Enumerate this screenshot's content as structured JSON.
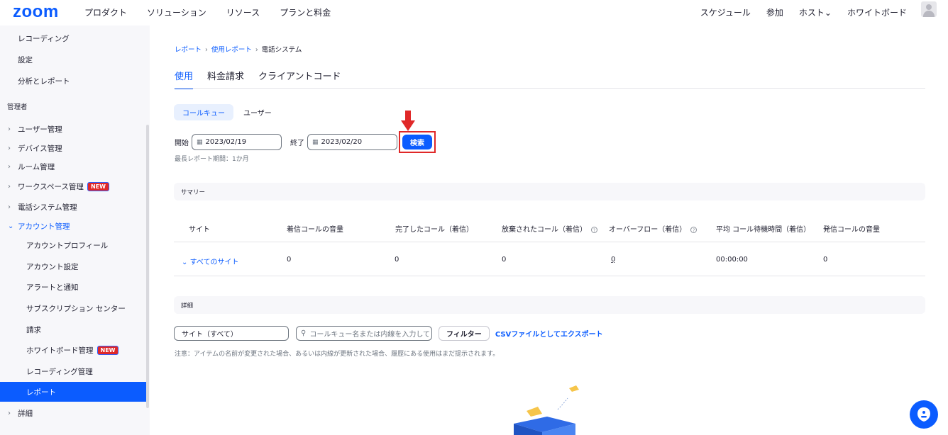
{
  "topnav": {
    "logo": "zoom",
    "left_items": [
      "プロダクト",
      "ソリューション",
      "リソース",
      "プランと料金"
    ],
    "right_items": [
      "スケジュール",
      "参加",
      "ホスト⌄",
      "ホワイトボード"
    ]
  },
  "sidebar": {
    "top_items": [
      "レコーディング",
      "設定",
      "分析とレポート"
    ],
    "section_label": "管理者",
    "groups": [
      "ユーザー管理",
      "デバイス管理",
      "ルーム管理",
      "ワークスペース管理",
      "電話システム管理",
      "アカウント管理"
    ],
    "sub_items": [
      "アカウントプロフィール",
      "アカウント設定",
      "アラートと通知",
      "サブスクリプション センター",
      "請求",
      "ホワイトボード管理",
      "レコーディング管理",
      "レポート"
    ],
    "more": "詳細",
    "new_badge": "NEW"
  },
  "breadcrumb": [
    "レポート",
    "使用レポート",
    "電話システム"
  ],
  "tabs": [
    "使用",
    "料金請求",
    "クライアントコード"
  ],
  "segments": [
    "コールキュー",
    "ユーザー"
  ],
  "date_filter": {
    "start_label": "開始",
    "start_value": "2023/02/19",
    "end_label": "終了",
    "end_value": "2023/02/20",
    "search_label": "検索",
    "hint": "最長レポート期間：1か月"
  },
  "summary": {
    "title": "サマリー",
    "columns": [
      "サイト",
      "着信コールの音量",
      "完了したコール（着信）",
      "放棄されたコール（着信）",
      "オーバーフロー（着信）",
      "平均 コール待機時間（着信）",
      "発信コールの音量"
    ],
    "row": [
      "すべてのサイト",
      "0",
      "0",
      "0",
      "0",
      "00:00:00",
      "0"
    ]
  },
  "details": {
    "title": "詳細",
    "site_select": "サイト（すべて）",
    "search_placeholder": "コールキュー名または内線を入力して",
    "filter_label": "フィルター",
    "export_label": "CSVファイルとしてエクスポート",
    "note": "注意：アイテムの名前が変更された場合、あるいは内線が更新された場合、履歴にある使用はまだ提示されます。"
  },
  "colors": {
    "accent": "#0b5cff",
    "highlight": "#e02828"
  }
}
